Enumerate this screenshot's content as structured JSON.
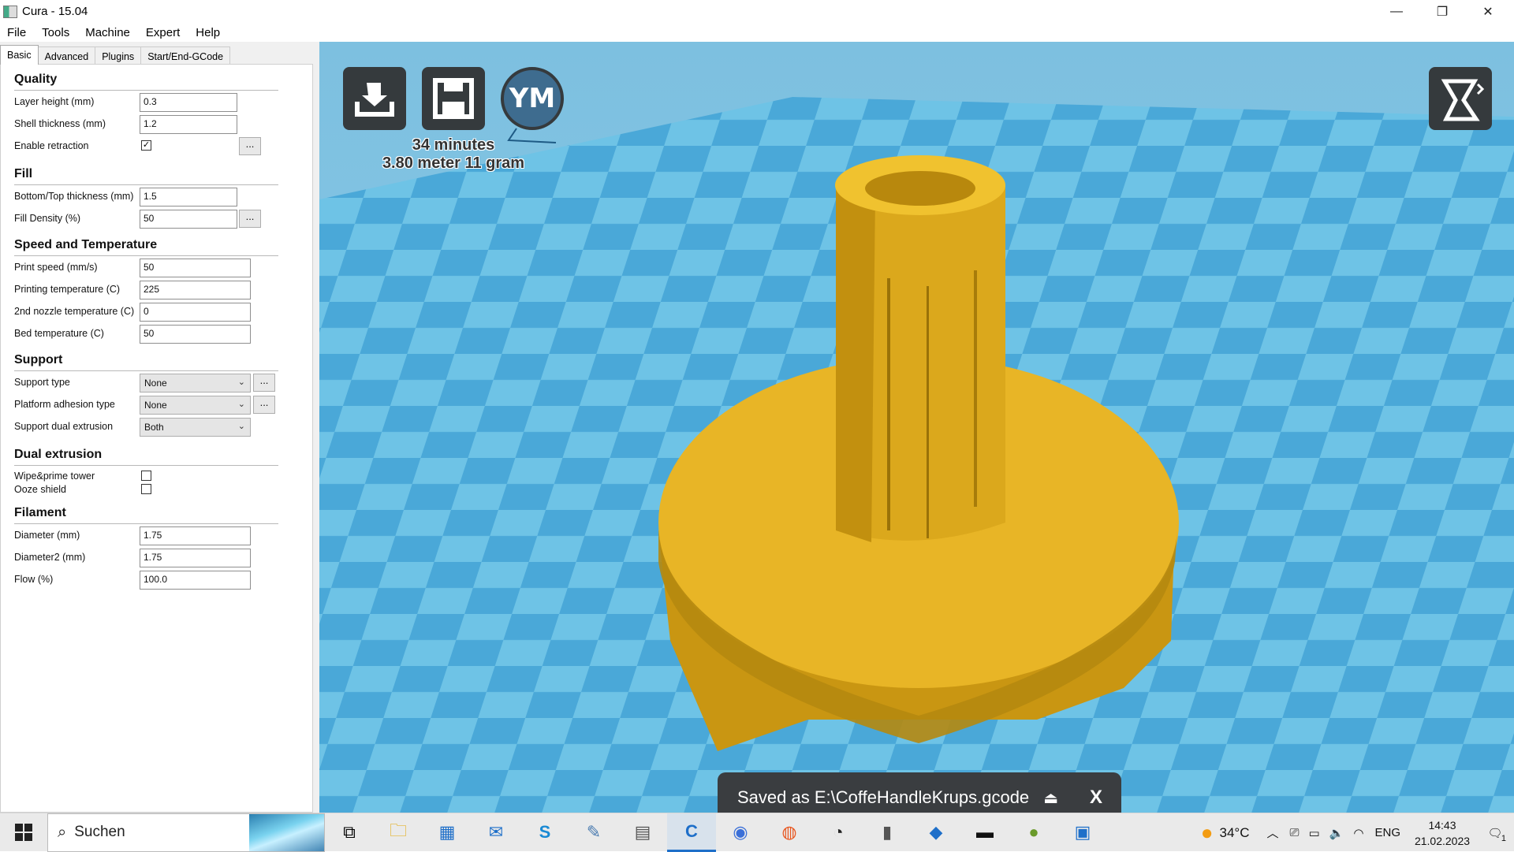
{
  "window": {
    "title": "Cura - 15.04"
  },
  "menu": [
    "File",
    "Tools",
    "Machine",
    "Expert",
    "Help"
  ],
  "tabs": [
    "Basic",
    "Advanced",
    "Plugins",
    "Start/End-GCode"
  ],
  "sections": {
    "quality": {
      "title": "Quality",
      "layer_height": {
        "label": "Layer height (mm)",
        "value": "0.3"
      },
      "shell_thickness": {
        "label": "Shell thickness (mm)",
        "value": "1.2"
      },
      "enable_retraction": {
        "label": "Enable retraction",
        "checked": "✓",
        "more": "..."
      }
    },
    "fill": {
      "title": "Fill",
      "bottom_top": {
        "label": "Bottom/Top thickness (mm)",
        "value": "1.5"
      },
      "fill_density": {
        "label": "Fill Density (%)",
        "value": "50",
        "more": "..."
      }
    },
    "speed": {
      "title": "Speed and Temperature",
      "print_speed": {
        "label": "Print speed (mm/s)",
        "value": "50"
      },
      "print_temp": {
        "label": "Printing temperature (C)",
        "value": "225"
      },
      "nozzle2_temp": {
        "label": "2nd nozzle temperature (C)",
        "value": "0"
      },
      "bed_temp": {
        "label": "Bed temperature (C)",
        "value": "50"
      }
    },
    "support": {
      "title": "Support",
      "support_type": {
        "label": "Support type",
        "value": "None",
        "more": "..."
      },
      "adhesion": {
        "label": "Platform adhesion type",
        "value": "None",
        "more": "..."
      },
      "dual": {
        "label": "Support dual extrusion",
        "value": "Both"
      }
    },
    "dual": {
      "title": "Dual extrusion",
      "wipe": {
        "label": "Wipe&prime tower"
      },
      "ooze": {
        "label": "Ooze shield"
      }
    },
    "filament": {
      "title": "Filament",
      "diameter": {
        "label": "Diameter (mm)",
        "value": "1.75"
      },
      "diameter2": {
        "label": "Diameter2 (mm)",
        "value": "1.75"
      },
      "flow": {
        "label": "Flow (%)",
        "value": "100.0"
      }
    }
  },
  "viewport": {
    "toolbar_ym": "YM",
    "stats_time": "34 minutes",
    "stats_material": "3.80 meter 11 gram",
    "toast": "Saved as E:\\CoffeHandleKrups.gcode",
    "toast_close": "X",
    "colors": {
      "bed_light": "#6ec3e6",
      "bed_dark": "#4aa8d8",
      "model": "#e8b526",
      "sky": "#a9d6ec"
    }
  },
  "taskbar": {
    "search_placeholder": "Suchen",
    "weather": "34°C",
    "lang": "ENG",
    "time": "14:43",
    "date": "21.02.2023",
    "notifications": "1"
  }
}
